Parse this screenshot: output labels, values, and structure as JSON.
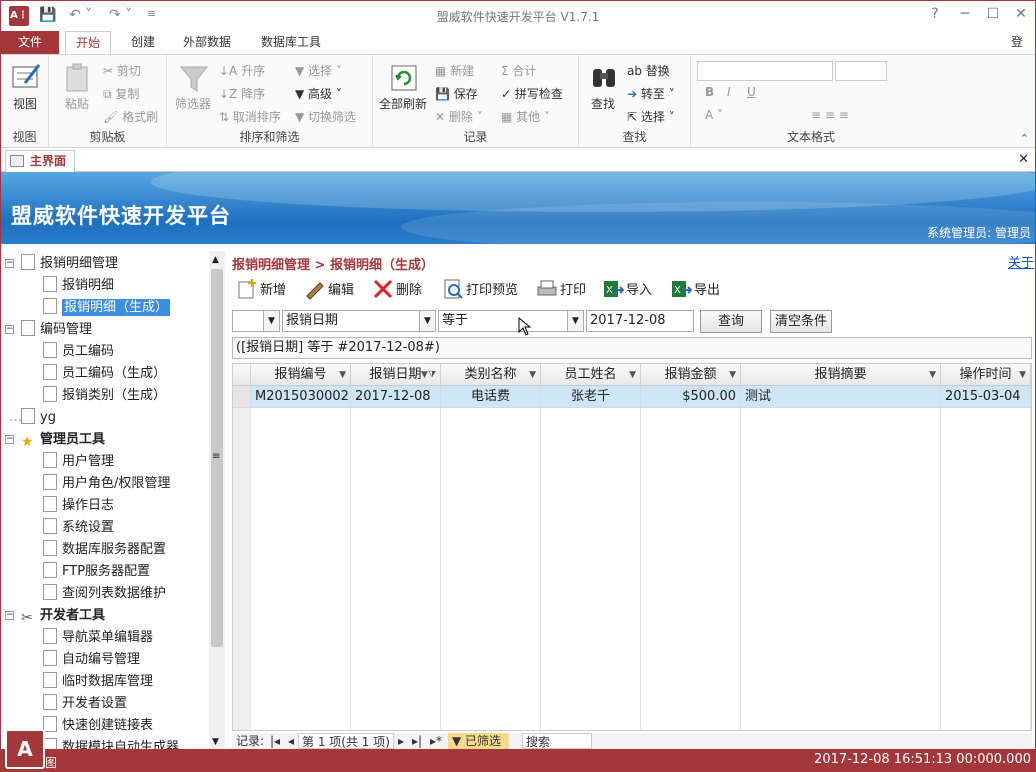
{
  "window": {
    "title": "盟威软件快速开发平台 V1.7.1",
    "help": "?",
    "signin": "登录"
  },
  "tabs": [
    "文件",
    "开始",
    "创建",
    "外部数据",
    "数据库工具"
  ],
  "ribbon": {
    "view": {
      "label": "视图",
      "group": "视图"
    },
    "clipboard": {
      "paste": "粘贴",
      "cut": "剪切",
      "copy": "复制",
      "format_painter": "格式刷",
      "group": "剪贴板"
    },
    "sort": {
      "filter": "筛选器",
      "asc": "升序",
      "desc": "降序",
      "remove_sort": "取消排序",
      "selection": "选择",
      "advanced": "高级",
      "toggle": "切换筛选",
      "group": "排序和筛选"
    },
    "records": {
      "refresh_all": "全部刷新",
      "new": "新建",
      "save": "保存",
      "delete": "删除",
      "totals": "合计",
      "spelling": "拼写检查",
      "more": "其他",
      "group": "记录"
    },
    "find": {
      "find": "查找",
      "replace": "替换",
      "goto": "转至",
      "select": "选择",
      "group": "查找"
    },
    "text": {
      "group": "文本格式",
      "bold": "B",
      "italic": "I",
      "underline": "U"
    }
  },
  "doc_tab": "主界面",
  "banner": {
    "title": "盟威软件快速开发平台",
    "user": "系统管理员: 管理员"
  },
  "tree": [
    {
      "label": "报销明细管理",
      "level": 0,
      "exp": "⊟"
    },
    {
      "label": "报销明细",
      "level": 1
    },
    {
      "label": "报销明细（生成）",
      "level": 1,
      "selected": true
    },
    {
      "label": "编码管理",
      "level": 0,
      "exp": "⊟"
    },
    {
      "label": "员工编码",
      "level": 1
    },
    {
      "label": "员工编码（生成）",
      "level": 1
    },
    {
      "label": "报销类别（生成）",
      "level": 1
    },
    {
      "label": "yg",
      "level": 0
    },
    {
      "label": "管理员工具",
      "level": 0,
      "exp": "⊟",
      "bold": true
    },
    {
      "label": "用户管理",
      "level": 1
    },
    {
      "label": "用户角色/权限管理",
      "level": 1
    },
    {
      "label": "操作日志",
      "level": 1
    },
    {
      "label": "系统设置",
      "level": 1
    },
    {
      "label": "数据库服务器配置",
      "level": 1
    },
    {
      "label": "FTP服务器配置",
      "level": 1
    },
    {
      "label": "查阅列表数据维护",
      "level": 1
    },
    {
      "label": "开发者工具",
      "level": 0,
      "exp": "⊟",
      "bold": true
    },
    {
      "label": "导航菜单编辑器",
      "level": 1
    },
    {
      "label": "自动编号管理",
      "level": 1
    },
    {
      "label": "临时数据库管理",
      "level": 1
    },
    {
      "label": "开发者设置",
      "level": 1
    },
    {
      "label": "快速创建链接表",
      "level": 1
    },
    {
      "label": "数据模块自动生成器",
      "level": 1
    }
  ],
  "main": {
    "breadcrumb": "报销明细管理 > 报销明细（生成）",
    "about": "关于",
    "toolbar": [
      "新增",
      "编辑",
      "删除",
      "打印预览",
      "打印",
      "导入",
      "导出"
    ],
    "filter": {
      "field": "报销日期",
      "operator": "等于",
      "value": "2017-12-08",
      "query": "查询",
      "clear": "清空条件",
      "expr": "([报销日期] 等于 #2017-12-08#)"
    },
    "columns": [
      "报销编号",
      "报销日期",
      "类别名称",
      "员工姓名",
      "报销金额",
      "报销摘要",
      "操作时间"
    ],
    "rows": [
      [
        "M2015030002",
        "2017-12-08",
        "电话费",
        "张老千",
        "$500.00",
        "测试",
        "2015-03-04"
      ]
    ],
    "nav": {
      "label": "记录:",
      "position": "第 1 项(共 1 项)",
      "filtered": "已筛选",
      "search": "搜索"
    }
  },
  "status": {
    "clock": "2017-12-08 16:51:13 00:000.000",
    "logo_caption": "图"
  },
  "colors": {
    "accent": "#a4373a",
    "banner": "#2a7ccd",
    "selected_row": "#cde6f7"
  }
}
